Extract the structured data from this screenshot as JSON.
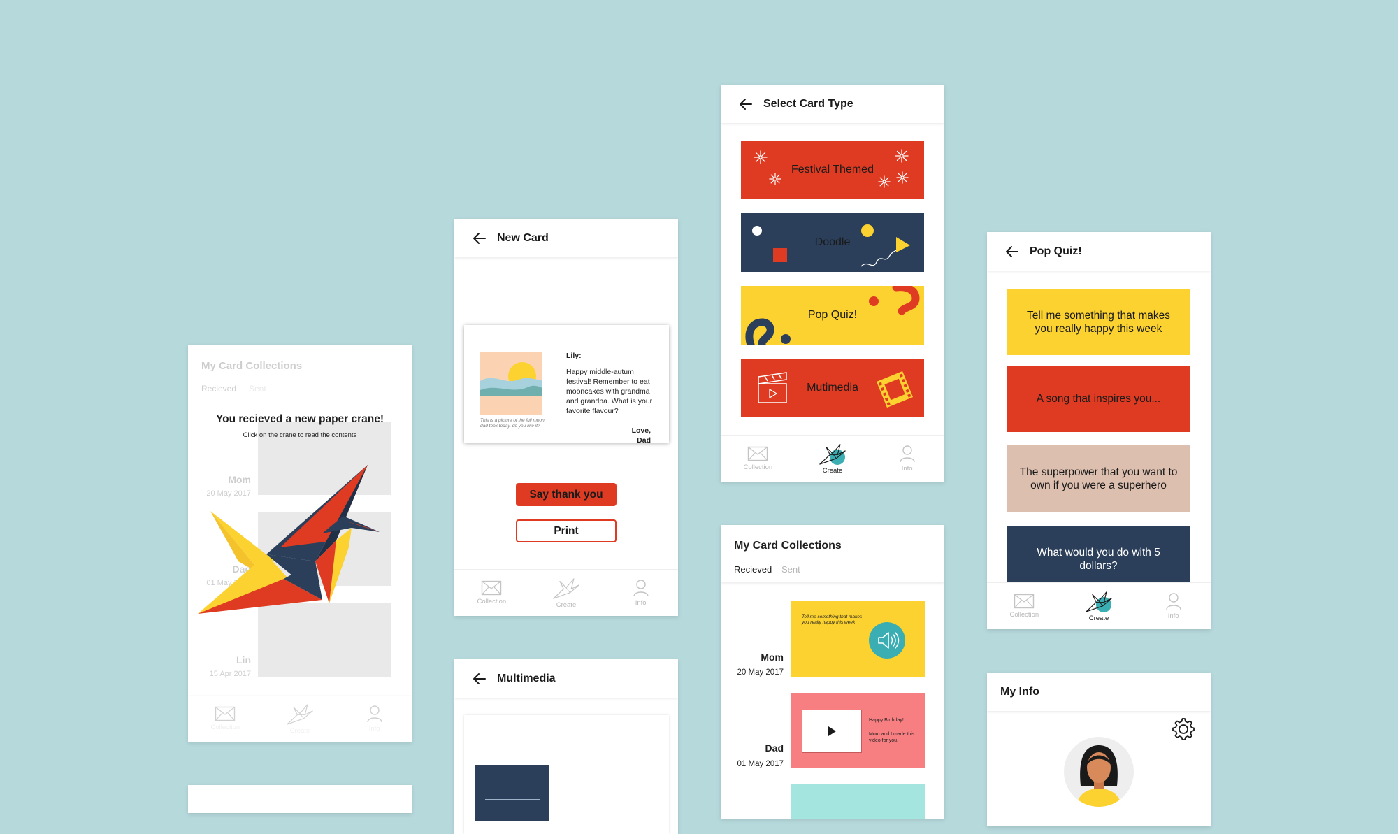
{
  "colors": {
    "background": "#b6d9dc",
    "red": "#de3b22",
    "navy": "#2b3f5a",
    "yellow": "#fcd230",
    "pink": "#f77f82",
    "peach": "#ddbfaf",
    "teal": "#3aaeb2",
    "mint": "#a4e6df"
  },
  "nav": {
    "collection": "Collection",
    "create": "Create",
    "info": "Info"
  },
  "screen_received": {
    "title": "My Card Collections",
    "tab_received": "Recieved",
    "tab_sent": "Sent",
    "headline": "You recieved a new paper crane!",
    "subline": "Click on the crane to read the contents",
    "entries": [
      {
        "name": "Mom",
        "date": "20 May 2017"
      },
      {
        "name": "Dad",
        "date": "01 May 2017"
      },
      {
        "name": "Lin",
        "date": "15 Apr 2017"
      }
    ]
  },
  "screen_new_card": {
    "title": "New Card",
    "caption": "This is a picture of the full moon dad took today, do you like it?",
    "greeting": "Lily:",
    "message": "Happy middle-autum festival! Remember to eat mooncakes with grandma and grandpa. What is your favorite flavour?",
    "signoff": "Love,",
    "sender": "Dad",
    "thank_button": "Say thank you",
    "print_button": "Print"
  },
  "screen_multimedia": {
    "title": "Multimedia"
  },
  "screen_select_type": {
    "title": "Select Card Type",
    "types": [
      "Festival Themed",
      "Doodle",
      "Pop Quiz!",
      "Mutimedia"
    ]
  },
  "screen_collections": {
    "title": "My Card Collections",
    "tab_received": "Recieved",
    "tab_sent": "Sent",
    "entries": [
      {
        "name": "Mom",
        "date": "20 May 2017",
        "text": "Tell me something that makes you really happy this week"
      },
      {
        "name": "Dad",
        "date": "01 May 2017",
        "text": "Happy Birthday!",
        "subtext": "Mom and I made this video for you."
      }
    ]
  },
  "screen_pop_quiz": {
    "title": "Pop Quiz!",
    "questions": [
      "Tell me something that makes you really happy this week",
      "A song that inspires you...",
      "The superpower that you want to own if you were a superhero",
      "What would you do with 5 dollars?"
    ]
  },
  "screen_my_info": {
    "title": "My Info"
  }
}
